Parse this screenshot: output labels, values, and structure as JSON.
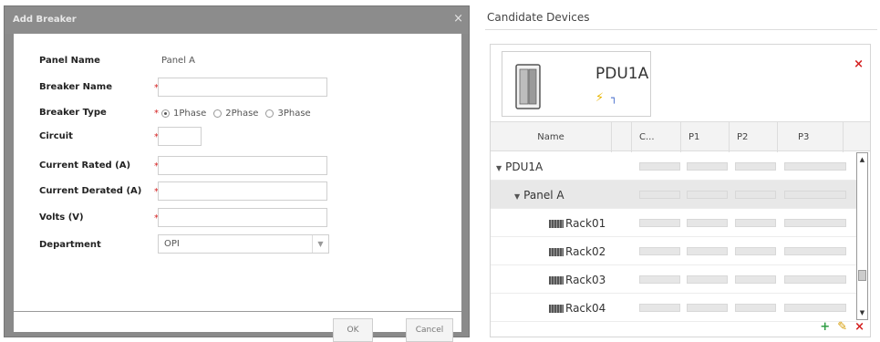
{
  "dialog": {
    "title": "Add Breaker",
    "close_symbol": "×",
    "fields": {
      "panel_name_label": "Panel Name",
      "panel_name_value": "Panel A",
      "breaker_name_label": "Breaker Name",
      "breaker_type_label": "Breaker Type",
      "circuit_label": "Circuit",
      "current_rated_label": "Current Rated (A)",
      "current_derated_label": "Current Derated (A)",
      "volts_label": "Volts (V)",
      "department_label": "Department",
      "department_value": "OPI"
    },
    "required_mark": "*",
    "breaker_types": [
      "1Phase",
      "2Phase",
      "3Phase"
    ],
    "selected_breaker_type": "1Phase",
    "ok_label": "OK",
    "cancel_label": "Cancel"
  },
  "candidate": {
    "title": "Candidate Devices",
    "device_name": "PDU1A",
    "columns": [
      "Name",
      "C...",
      "P1",
      "P2",
      "P3"
    ],
    "rows": [
      {
        "label": "PDU1A"
      },
      {
        "label": "Panel A"
      },
      {
        "label": "Rack01"
      },
      {
        "label": "Rack02"
      },
      {
        "label": "Rack03"
      },
      {
        "label": "Rack04"
      }
    ],
    "actions": {
      "add": "+",
      "edit": "✎",
      "delete": "×"
    }
  },
  "colors": {
    "required": "#d42020",
    "add": "#2f9e44",
    "edit": "#d59b00",
    "delete": "#d42020"
  },
  "icons": [
    "close-icon",
    "rack-device-icon",
    "power-bolt-icon",
    "plug-icon",
    "expand-triangle-icon",
    "rack-icon",
    "scroll-up-icon",
    "scroll-down-icon",
    "add-icon",
    "edit-icon",
    "delete-icon"
  ]
}
